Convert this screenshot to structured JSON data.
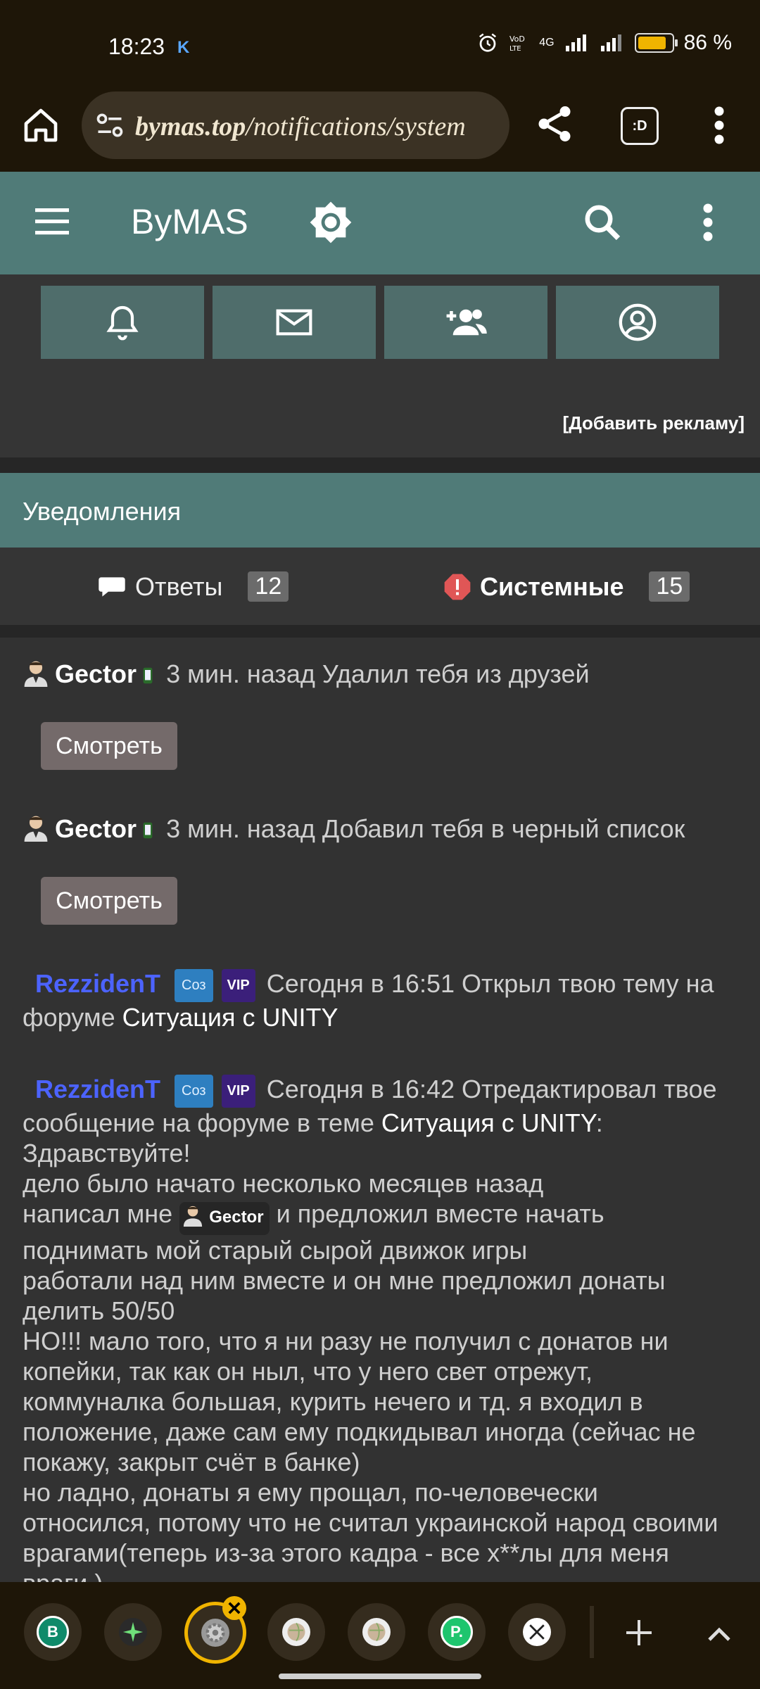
{
  "status_bar": {
    "time": "18:23",
    "carrier_mark": "K",
    "network": "4G",
    "battery_percent": "86 %",
    "battery_level": 0.86
  },
  "browser": {
    "url_domain": "bymas.top",
    "url_path": "/notifications/system",
    "tab_label": ":D"
  },
  "app": {
    "title": "ByMAS",
    "ad_link": "[Добавить рекламу]"
  },
  "notifications": {
    "header": "Уведомления",
    "tabs": [
      {
        "label": "Ответы",
        "count": "12"
      },
      {
        "label": "Системные",
        "count": "15"
      }
    ],
    "view_button": "Смотреть",
    "items": [
      {
        "user": "Gector",
        "time": "3 мин. назад",
        "action": "Удалил тебя из друзей"
      },
      {
        "user": "Gector",
        "time": "3 мин. назад",
        "action": "Добавил тебя в черный список"
      },
      {
        "user": "RezzidenT",
        "badge_role": "Соз",
        "badge_vip": "VIP",
        "time": "Сегодня в 16:51",
        "action": "Открыл твою тему на форуме",
        "topic": "Ситуация с UNITY"
      },
      {
        "user": "RezzidenT",
        "badge_role": "Соз",
        "badge_vip": "VIP",
        "time": "Сегодня в 16:42",
        "action": "Отредактировал твое сообщение на форуме в теме",
        "topic": "Ситуация с UNITY",
        "line1": "Здравствуйте!",
        "line2": "дело было начато несколько месяцев назад",
        "line3a": "написал мне",
        "mention": "Gector",
        "line3b": "и предложил вместе начать",
        "line4": "поднимать мой старый сырой движок игры",
        "line5": "работали над ним вместе и он мне предложил донаты делить 50/50",
        "line6": "НО!!! мало того, что я ни разу не получил с донатов ни копейки, так как он ныл, что у него свет отрежут, коммуналка большая, курить нечего и тд. я входил в положение, даже сам ему подкидывал иногда (сейчас не покажу, закрыт счёт в банке)",
        "line7": "но ладно, донаты я ему прощал, по-человечески относился, потому что не считал украинской народ своими врагами(теперь из-за этого кадра - все х**лы для меня враги )"
      }
    ]
  },
  "tabstrip": {
    "tab1_letter": "B",
    "tab6_letter": "P."
  }
}
